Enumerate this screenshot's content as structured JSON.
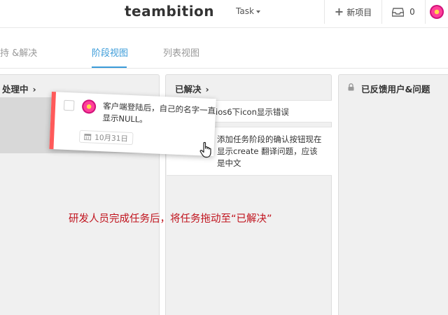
{
  "header": {
    "brand": "teambition",
    "project_select": "Task",
    "new_project": "新项目",
    "inbox_count": "0",
    "icons": {
      "new_project": "plus-icon",
      "inbox": "inbox-icon",
      "user": "avatar"
    }
  },
  "tabs": [
    {
      "label": "持 &解决"
    },
    {
      "label": "阶段视图",
      "active": true
    },
    {
      "label": "列表视图"
    }
  ],
  "columns": [
    {
      "title": "处理中",
      "tasks": []
    },
    {
      "title": "已解决",
      "tasks": [
        {
          "text": "ios6下icon显示错误"
        },
        {
          "text": "添加任务阶段的确认按钮现在显示create 翻译问题，应该是中文"
        }
      ]
    },
    {
      "title": "已反馈用户&问题",
      "locked": true,
      "tasks": []
    }
  ],
  "dragging_card": {
    "text": "客户端登陆后，自己的名字一直显示NULL。",
    "due": "10月31日",
    "color": "#ff5a5a"
  },
  "caption": "研发人员完成任务后，将任务拖动至“已解决”",
  "colors": {
    "accent": "#3a9bd9",
    "caption": "#c0121c",
    "priority": "#ff5a5a"
  }
}
